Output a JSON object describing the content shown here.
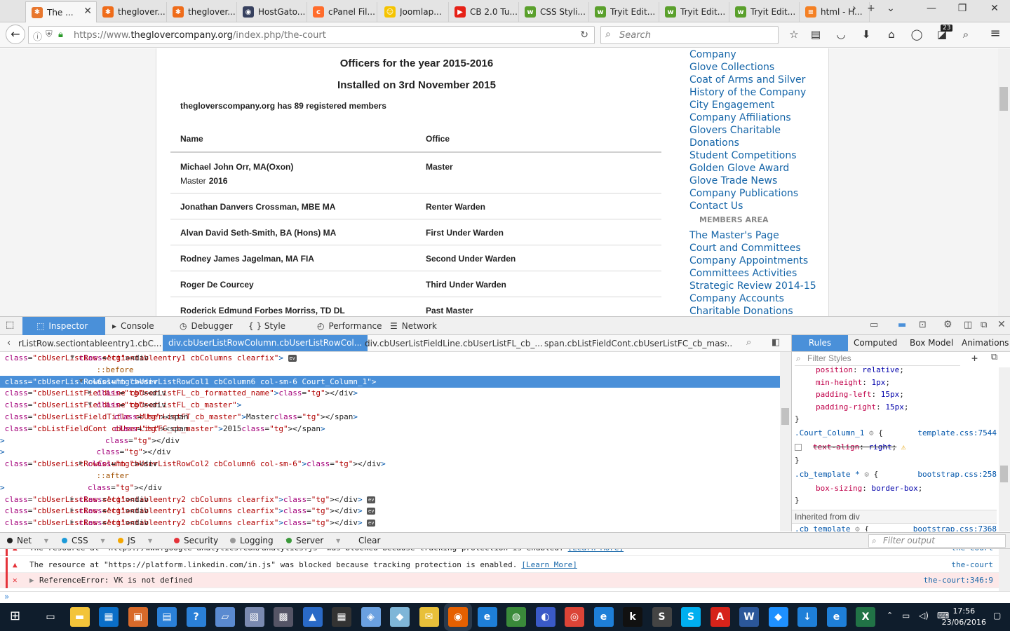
{
  "tabs": [
    {
      "title": "The ...",
      "fav_color": "#e8772e",
      "fav_glyph": "✱"
    },
    {
      "title": "theglover...",
      "fav_color": "#ef6c1a",
      "fav_glyph": "✱"
    },
    {
      "title": "theglover...",
      "fav_color": "#ef6c1a",
      "fav_glyph": "✱"
    },
    {
      "title": "HostGato...",
      "fav_color": "#37415f",
      "fav_glyph": "◉"
    },
    {
      "title": "cPanel Fil...",
      "fav_color": "#ff6c2c",
      "fav_glyph": "c"
    },
    {
      "title": "Joomlap...",
      "fav_color": "#f5c400",
      "fav_glyph": "☺"
    },
    {
      "title": "CB 2.0 Tu...",
      "fav_color": "#e62117",
      "fav_glyph": "▶"
    },
    {
      "title": "CSS Styli...",
      "fav_color": "#5aa02c",
      "fav_glyph": "w"
    },
    {
      "title": "Tryit Edit...",
      "fav_color": "#5aa02c",
      "fav_glyph": "w"
    },
    {
      "title": "Tryit Edit...",
      "fav_color": "#5aa02c",
      "fav_glyph": "w"
    },
    {
      "title": "Tryit Edit...",
      "fav_color": "#5aa02c",
      "fav_glyph": "w"
    },
    {
      "title": "html - H...",
      "fav_color": "#f48024",
      "fav_glyph": "≡"
    }
  ],
  "nav": {
    "url_prefix": "https://www.",
    "url_domain": "theglovercompany.org",
    "url_path": "/index.php/the-court",
    "search_placeholder": "Search",
    "badge": "23"
  },
  "page": {
    "title1": "Officers for the year 2015-2016",
    "title2": "Installed on 3rd November 2015",
    "members_note": "thegloverscompany.org has 89 registered members",
    "col_name": "Name",
    "col_office": "Office",
    "rows": [
      {
        "name": "Michael John Orr, MA(Oxon)",
        "office": "Master",
        "sub_label": "Master",
        "sub_value": "2016"
      },
      {
        "name": "Jonathan Danvers Crossman, MBE MA",
        "office": "Renter Warden"
      },
      {
        "name": "Alvan David Seth-Smith, BA (Hons) MA",
        "office": "First Under Warden"
      },
      {
        "name": "Rodney James Jagelman, MA FIA",
        "office": "Second Under Warden"
      },
      {
        "name": "Roger De Courcey",
        "office": "Third Under Warden"
      },
      {
        "name": "Roderick Edmund Forbes Morriss, TD DL",
        "office": "Past Master"
      }
    ],
    "sidebar_links_top": [
      "Company",
      "Glove Collections",
      "Coat of Arms and Silver",
      "History of the Company",
      "City Engagement",
      "Company Affiliations",
      "Glovers Charitable",
      "Donations",
      "Student Competitions",
      "Golden Glove Award",
      "Glove Trade News",
      "Company Publications",
      "Contact Us"
    ],
    "members_area": "MEMBERS AREA",
    "sidebar_links_bottom": [
      "The Master's Page",
      "Court and Committees",
      "Company Appointments",
      "Committees Activities",
      "Strategic Review 2014-15",
      "Company Accounts",
      "Charitable Donations"
    ]
  },
  "devtools": {
    "tabs": [
      "Inspector",
      "Console",
      "Debugger",
      "{ } Style Editor",
      "Performance",
      "Network"
    ],
    "crumbs": [
      "rListRow.sectiontableentry1.cbC...",
      "div.cbUserListRowColumn.cbUserListRowCol...",
      "div.cbUserListFieldLine.cbUserListFL_cb_...",
      "span.cbListFieldCont.cbUserListFC_cb_mas..."
    ],
    "markup": [
      {
        "indent": 9,
        "arrow": "▼",
        "html": "<div class=\"cbUserListRow sectiontableentry1 cbColumns clearfix\">",
        "ev": true
      },
      {
        "indent": 11,
        "pseudo": "::before"
      },
      {
        "indent": 10,
        "arrow": "▼",
        "html": "<div class=\"cbUserListRowColumn cbUserListRowCol1 cbColumn6 col-sm-6 Court_Column_1\">",
        "selected": true
      },
      {
        "indent": 11,
        "arrow": "▶",
        "html": "<div class=\"cbUserListFieldLine cbUserListFL_cb_formatted_name\"></div>"
      },
      {
        "indent": 11,
        "arrow": "▼",
        "html": "<div class=\"cbUserListFieldLine cbUserListFL_cb_master\">"
      },
      {
        "indent": 13,
        "html": "<span class=\"cbUserListFieldTitle cbUserListFT_cb_master\">Master</span>"
      },
      {
        "indent": 13,
        "html": "<span class=\"cbListFieldCont cbUserListFC_cb_master\">2015</span>"
      },
      {
        "indent": 12,
        "html": "</div>"
      },
      {
        "indent": 11,
        "html": "</div>"
      },
      {
        "indent": 10,
        "arrow": "▶",
        "html": "<div class=\"cbUserListRowColumn cbUserListRowCol2 cbColumn6 col-sm-6\"></div>"
      },
      {
        "indent": 11,
        "pseudo": "::after"
      },
      {
        "indent": 10,
        "html": "</div>"
      },
      {
        "indent": 9,
        "arrow": "▶",
        "html": "<div class=\"cbUserListRow sectiontableentry2 cbColumns clearfix\"></div>",
        "ev": true
      },
      {
        "indent": 9,
        "arrow": "▶",
        "html": "<div class=\"cbUserListRow sectiontableentry1 cbColumns clearfix\"></div>",
        "ev": true
      },
      {
        "indent": 9,
        "arrow": "▶",
        "html": "<div class=\"cbUserListRow sectiontableentry2 cbColumns clearfix\"></div>",
        "ev": true
      }
    ],
    "rules_tabs": [
      "Rules",
      "Computed",
      "Box Model",
      "Animations"
    ],
    "filter_placeholder": "Filter Styles",
    "rules": [
      {
        "t": "decl",
        "p": "position",
        "v": "relative"
      },
      {
        "t": "decl",
        "p": "min-height",
        "v": "1px"
      },
      {
        "t": "decl",
        "p": "padding-left",
        "v": "15px"
      },
      {
        "t": "decl",
        "p": "padding-right",
        "v": "15px"
      },
      {
        "t": "close"
      },
      {
        "t": "sel",
        "s": ".Court_Column_1",
        "src": "template.css:7544"
      },
      {
        "t": "strike",
        "p": "text-align",
        "v": "right"
      },
      {
        "t": "close"
      },
      {
        "t": "sel",
        "s": ".cb_template *",
        "src": "bootstrap.css:258"
      },
      {
        "t": "decl",
        "p": "box-sizing",
        "v": "border-box"
      },
      {
        "t": "close"
      },
      {
        "t": "inherit",
        "s": "Inherited from div"
      },
      {
        "t": "sel",
        "s": ".cb_template",
        "src": "bootstrap.css:7368"
      }
    ],
    "console_filters": [
      {
        "label": "Net",
        "color": "#222"
      },
      {
        "label": "CSS",
        "color": "#1c9ad8"
      },
      {
        "label": "JS",
        "color": "#f4a700"
      },
      {
        "label": "Security",
        "color": "#e5333a"
      },
      {
        "label": "Logging",
        "color": "#999"
      },
      {
        "label": "Server",
        "color": "#3a9a3a"
      }
    ],
    "clear_label": "Clear",
    "filter_output_placeholder": "Filter output",
    "console_lines": [
      {
        "msg": "The resource at \"https://www.google-analytics.com/analytics.js\" was blocked because tracking protection is enabled.",
        "link": "[Learn More]",
        "loc": "the-court",
        "err": false
      },
      {
        "msg": "The resource at \"https://platform.linkedin.com/in.js\" was blocked because tracking protection is enabled.",
        "link": "[Learn More]",
        "loc": "the-court",
        "err": false
      },
      {
        "msg": "ReferenceError: VK is not defined",
        "link": "",
        "loc": "the-court:346:9",
        "err": true
      }
    ],
    "prompt": "»"
  },
  "taskbar": {
    "icons": [
      {
        "name": "task-view-icon",
        "color": "#0f1d2c",
        "glyph": "▭"
      },
      {
        "name": "file-explorer-icon",
        "color": "#f3c43a",
        "glyph": "▬"
      },
      {
        "name": "store-icon",
        "color": "#0a6ec7",
        "glyph": "▦"
      },
      {
        "name": "app-icon-1",
        "color": "#d86a2a",
        "glyph": "▣"
      },
      {
        "name": "app-icon-2",
        "color": "#2a80d8",
        "glyph": "▤"
      },
      {
        "name": "help-icon",
        "color": "#2a80d8",
        "glyph": "?"
      },
      {
        "name": "app-icon-3",
        "color": "#5a8ad0",
        "glyph": "▱"
      },
      {
        "name": "app-icon-4",
        "color": "#7a8ab0",
        "glyph": "▧"
      },
      {
        "name": "app-icon-5",
        "color": "#556",
        "glyph": "▩"
      },
      {
        "name": "app-icon-6",
        "color": "#2a6ac7",
        "glyph": "▲"
      },
      {
        "name": "calculator-icon",
        "color": "#333",
        "glyph": "▦"
      },
      {
        "name": "app-icon-7",
        "color": "#6aa0e0",
        "glyph": "◈"
      },
      {
        "name": "app-icon-8",
        "color": "#7fb6d8",
        "glyph": "◆"
      },
      {
        "name": "app-icon-9",
        "color": "#e8c03a",
        "glyph": "✉"
      },
      {
        "name": "firefox-icon",
        "color": "#e66000",
        "glyph": "◉"
      },
      {
        "name": "edge-icon",
        "color": "#1e7fd8",
        "glyph": "e"
      },
      {
        "name": "globe-icon",
        "color": "#3a8a3a",
        "glyph": "◍"
      },
      {
        "name": "app-icon-10",
        "color": "#3a5ac7",
        "glyph": "◐"
      },
      {
        "name": "chrome-icon",
        "color": "#db4437",
        "glyph": "◎"
      },
      {
        "name": "edge-icon-2",
        "color": "#1e7fd8",
        "glyph": "e"
      },
      {
        "name": "kindle-icon",
        "color": "#111",
        "glyph": "k"
      },
      {
        "name": "app-icon-11",
        "color": "#444",
        "glyph": "S"
      },
      {
        "name": "skype-icon",
        "color": "#00aff0",
        "glyph": "S"
      },
      {
        "name": "acrobat-icon",
        "color": "#d6231a",
        "glyph": "A"
      },
      {
        "name": "word-icon",
        "color": "#2b579a",
        "glyph": "W"
      },
      {
        "name": "messenger-icon",
        "color": "#1e90ff",
        "glyph": "◆"
      },
      {
        "name": "download-icon",
        "color": "#1e7fd8",
        "glyph": "↓"
      },
      {
        "name": "ie-icon",
        "color": "#1e7fd8",
        "glyph": "e"
      },
      {
        "name": "excel-icon",
        "color": "#217346",
        "glyph": "X"
      }
    ],
    "time": "17:56",
    "date": "23/06/2016"
  }
}
